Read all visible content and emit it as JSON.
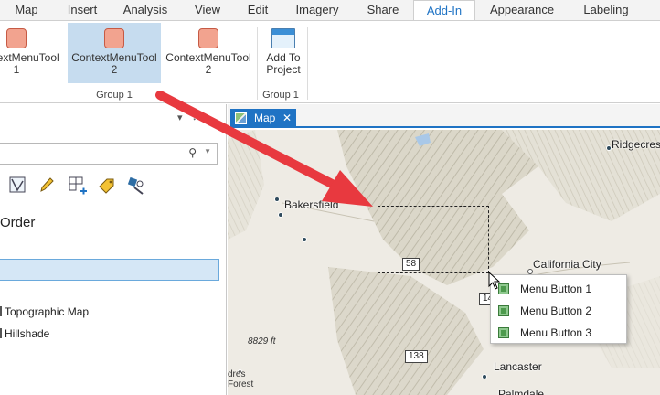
{
  "ribbon": {
    "tabs": [
      "Map",
      "Insert",
      "Analysis",
      "View",
      "Edit",
      "Imagery",
      "Share",
      "Add-In",
      "Appearance",
      "Labeling"
    ],
    "active_tab": "Add-In",
    "buttons": [
      {
        "line1": "ContextMenuTool",
        "line2": "1"
      },
      {
        "line1": "ContextMenuTool",
        "line2": "2"
      },
      {
        "line1": "ContextMenuTool",
        "line2": "2"
      },
      {
        "line1": "Add To",
        "line2": "Project"
      }
    ],
    "groups": [
      "Group 1",
      "Group 1"
    ]
  },
  "pane": {
    "pin_glyph": "↕",
    "order_heading": "Order",
    "layers": [
      "Topographic Map",
      "Hillshade"
    ]
  },
  "map": {
    "tab_label": "Map",
    "cities": [
      "Ridgecrest",
      "Bakersfield",
      "California City",
      "Lancaster",
      "Palmdale"
    ],
    "shields": [
      "58",
      "14",
      "138"
    ],
    "elevation": "8829 ft",
    "minor_labels": [
      "dres",
      "Forest"
    ]
  },
  "context_menu": {
    "items": [
      "Menu Button 1",
      "Menu Button 2",
      "Menu Button 3"
    ]
  },
  "colors": {
    "accent": "#1f73c4",
    "arrow": "#e8393f",
    "selected_button": "#c6dcef"
  }
}
